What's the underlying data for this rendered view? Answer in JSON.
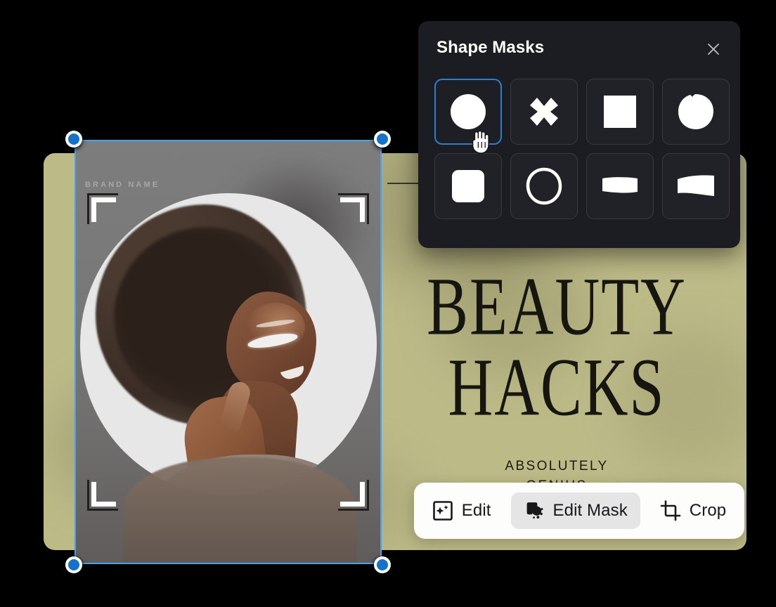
{
  "panel": {
    "title": "Shape Masks",
    "close_icon": "close-icon",
    "shapes": [
      {
        "id": "circle",
        "label": "Circle",
        "icon": "circle-shape-icon",
        "selected": true
      },
      {
        "id": "cross",
        "label": "Cross",
        "icon": "cross-shape-icon",
        "selected": false
      },
      {
        "id": "square",
        "label": "Square",
        "icon": "square-shape-icon",
        "selected": false
      },
      {
        "id": "blob-circle",
        "label": "Blob Circle",
        "icon": "blob-circle-shape-icon",
        "selected": false
      },
      {
        "id": "rounded-square",
        "label": "Rounded Square",
        "icon": "rounded-square-shape-icon",
        "selected": false
      },
      {
        "id": "circle-outline",
        "label": "Circle Outline",
        "icon": "circle-outline-shape-icon",
        "selected": false
      },
      {
        "id": "banner",
        "label": "Banner",
        "icon": "banner-shape-icon",
        "selected": false
      },
      {
        "id": "flag",
        "label": "Flag",
        "icon": "flag-shape-icon",
        "selected": false
      }
    ],
    "cursor": "hand-cursor-icon",
    "bg_color": "#1c1d22",
    "selected_border_color": "#2f7fd1"
  },
  "toolbar": {
    "buttons": [
      {
        "id": "edit",
        "label": "Edit",
        "icon": "magic-edit-icon",
        "active": false
      },
      {
        "id": "edit-mask",
        "label": "Edit Mask",
        "icon": "mask-icon",
        "active": true
      },
      {
        "id": "crop",
        "label": "Crop",
        "icon": "crop-icon",
        "active": false
      }
    ],
    "active_bg": "#e5e5e6",
    "bg_color": "#fdfdfb"
  },
  "canvas": {
    "poster": {
      "bg_color": "#bcba87",
      "title_line1": "BEAUTY",
      "title_line2": "HACKS",
      "subtitle": "ABSOLUTELY\nGENIUS",
      "arrow_icon": "arrow-right-icon"
    },
    "selection": {
      "brand_name": "BRAND NAME",
      "frame_color": "#4aa3e8",
      "handle_color": "#1573c8",
      "handles": [
        "top-left",
        "top-right",
        "bottom-left",
        "bottom-right"
      ],
      "brackets": [
        "top-left",
        "top-right",
        "bottom-left",
        "bottom-right"
      ],
      "mask_shape": "ellipse"
    }
  },
  "background_color": "#000000"
}
